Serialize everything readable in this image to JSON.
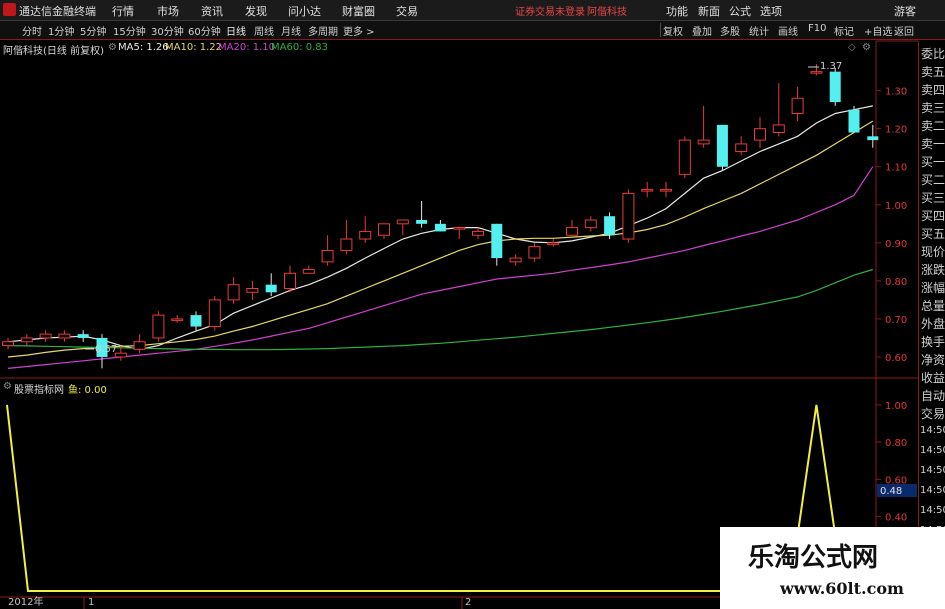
{
  "app": {
    "title": "通达信金融终端"
  },
  "menu": [
    "行情",
    "市场",
    "资讯",
    "发现",
    "问小达",
    "财富圈",
    "交易"
  ],
  "status": {
    "warning": "证券交易未登录",
    "broker": "阿偕科技"
  },
  "menu_right": [
    "功能",
    "新面",
    "公式",
    "选项",
    "游客"
  ],
  "periods": [
    "分时",
    "1分钟",
    "5分钟",
    "15分钟",
    "30分钟",
    "60分钟",
    "日线",
    "周线",
    "月线",
    "多周期",
    "更多 >"
  ],
  "tools": [
    "复权",
    "叠加",
    "多股",
    "统计",
    "画线",
    "F10",
    "标记",
    "+自选",
    "返回"
  ],
  "stock_legend": {
    "title": "阿偕科技(日线 前复权)",
    "ma5": "MA5: 1.26",
    "ma10": "MA10: 1.22",
    "ma20": "MA20: 1.10",
    "ma60": "MA60: 0.83"
  },
  "indicator_legend": {
    "name": "股票指标网",
    "value": "鱼: 0.00"
  },
  "annotations": {
    "high": "1.37",
    "low": "0.57",
    "cursor_value": "0.48"
  },
  "year_label": "2012年",
  "month_labels": [
    "1",
    "2"
  ],
  "colors": {
    "up": "#e83a3a",
    "down": "#54f0f0",
    "ma5": "#e8e8e8",
    "ma10": "#e8d860",
    "ma20": "#d040d0",
    "ma60": "#30b040",
    "indicator": "#f0f040",
    "grid": "#8a1a1a"
  },
  "right_names": [
    "委比",
    "卖五",
    "卖四",
    "卖三",
    "卖二",
    "卖一",
    "买一",
    "买二",
    "买三",
    "买四",
    "买五",
    "现价",
    "涨跌",
    "涨幅",
    "总量",
    "外盘",
    "换手",
    "净资",
    "收益",
    "自动",
    "交易"
  ],
  "watermark": {
    "cn": "乐淘公式网",
    "url": "www.60lt.com"
  },
  "chart_data": [
    {
      "type": "candlestick",
      "title": "阿偕科技(日线 前复权)",
      "ylim": [
        0.55,
        1.42
      ],
      "y_ticks": [
        "1.30",
        "1.20",
        "1.10",
        "1.00",
        "0.90",
        "0.80",
        "0.70",
        "0.60"
      ],
      "candles": [
        {
          "o": 0.63,
          "h": 0.65,
          "l": 0.62,
          "c": 0.64
        },
        {
          "o": 0.64,
          "h": 0.66,
          "l": 0.63,
          "c": 0.65
        },
        {
          "o": 0.65,
          "h": 0.67,
          "l": 0.64,
          "c": 0.66
        },
        {
          "o": 0.65,
          "h": 0.67,
          "l": 0.64,
          "c": 0.66
        },
        {
          "o": 0.66,
          "h": 0.67,
          "l": 0.64,
          "c": 0.65
        },
        {
          "o": 0.65,
          "h": 0.66,
          "l": 0.57,
          "c": 0.6
        },
        {
          "o": 0.6,
          "h": 0.63,
          "l": 0.59,
          "c": 0.61
        },
        {
          "o": 0.62,
          "h": 0.66,
          "l": 0.61,
          "c": 0.64
        },
        {
          "o": 0.65,
          "h": 0.72,
          "l": 0.64,
          "c": 0.71
        },
        {
          "o": 0.7,
          "h": 0.71,
          "l": 0.69,
          "c": 0.7
        },
        {
          "o": 0.71,
          "h": 0.72,
          "l": 0.67,
          "c": 0.68
        },
        {
          "o": 0.68,
          "h": 0.76,
          "l": 0.67,
          "c": 0.75
        },
        {
          "o": 0.75,
          "h": 0.81,
          "l": 0.74,
          "c": 0.79
        },
        {
          "o": 0.77,
          "h": 0.8,
          "l": 0.75,
          "c": 0.78
        },
        {
          "o": 0.79,
          "h": 0.82,
          "l": 0.76,
          "c": 0.77
        },
        {
          "o": 0.78,
          "h": 0.84,
          "l": 0.77,
          "c": 0.82
        },
        {
          "o": 0.82,
          "h": 0.84,
          "l": 0.82,
          "c": 0.83
        },
        {
          "o": 0.85,
          "h": 0.92,
          "l": 0.84,
          "c": 0.88
        },
        {
          "o": 0.88,
          "h": 0.96,
          "l": 0.87,
          "c": 0.91
        },
        {
          "o": 0.91,
          "h": 0.97,
          "l": 0.9,
          "c": 0.93
        },
        {
          "o": 0.92,
          "h": 0.95,
          "l": 0.91,
          "c": 0.95
        },
        {
          "o": 0.95,
          "h": 0.96,
          "l": 0.92,
          "c": 0.96
        },
        {
          "o": 0.96,
          "h": 1.01,
          "l": 0.94,
          "c": 0.95
        },
        {
          "o": 0.95,
          "h": 0.96,
          "l": 0.93,
          "c": 0.93
        },
        {
          "o": 0.94,
          "h": 0.94,
          "l": 0.91,
          "c": 0.94
        },
        {
          "o": 0.92,
          "h": 0.94,
          "l": 0.91,
          "c": 0.93
        },
        {
          "o": 0.95,
          "h": 0.95,
          "l": 0.84,
          "c": 0.86
        },
        {
          "o": 0.85,
          "h": 0.87,
          "l": 0.84,
          "c": 0.86
        },
        {
          "o": 0.86,
          "h": 0.9,
          "l": 0.85,
          "c": 0.89
        },
        {
          "o": 0.9,
          "h": 0.91,
          "l": 0.89,
          "c": 0.9
        },
        {
          "o": 0.92,
          "h": 0.96,
          "l": 0.92,
          "c": 0.94
        },
        {
          "o": 0.94,
          "h": 0.97,
          "l": 0.93,
          "c": 0.96
        },
        {
          "o": 0.97,
          "h": 0.98,
          "l": 0.91,
          "c": 0.92
        },
        {
          "o": 0.91,
          "h": 1.04,
          "l": 0.9,
          "c": 1.03
        },
        {
          "o": 1.04,
          "h": 1.06,
          "l": 1.02,
          "c": 1.04
        },
        {
          "o": 1.04,
          "h": 1.06,
          "l": 1.02,
          "c": 1.04
        },
        {
          "o": 1.08,
          "h": 1.18,
          "l": 1.07,
          "c": 1.17
        },
        {
          "o": 1.16,
          "h": 1.26,
          "l": 1.15,
          "c": 1.17
        },
        {
          "o": 1.21,
          "h": 1.21,
          "l": 1.09,
          "c": 1.1
        },
        {
          "o": 1.14,
          "h": 1.18,
          "l": 1.13,
          "c": 1.16
        },
        {
          "o": 1.17,
          "h": 1.23,
          "l": 1.15,
          "c": 1.2
        },
        {
          "o": 1.19,
          "h": 1.32,
          "l": 1.18,
          "c": 1.21
        },
        {
          "o": 1.24,
          "h": 1.31,
          "l": 1.22,
          "c": 1.28
        },
        {
          "o": 1.35,
          "h": 1.37,
          "l": 1.34,
          "c": 1.35
        },
        {
          "o": 1.35,
          "h": 1.36,
          "l": 1.26,
          "c": 1.27
        },
        {
          "o": 1.25,
          "h": 1.26,
          "l": 1.19,
          "c": 1.19
        },
        {
          "o": 1.18,
          "h": 1.21,
          "l": 1.15,
          "c": 1.17
        }
      ],
      "ma_lines": [
        {
          "name": "MA5",
          "values": [
            0.64,
            0.645,
            0.65,
            0.652,
            0.655,
            0.645,
            0.63,
            0.62,
            0.63,
            0.65,
            0.668,
            0.685,
            0.715,
            0.735,
            0.755,
            0.775,
            0.79,
            0.81,
            0.833,
            0.86,
            0.885,
            0.91,
            0.925,
            0.935,
            0.94,
            0.94,
            0.925,
            0.91,
            0.902,
            0.9,
            0.905,
            0.915,
            0.925,
            0.945,
            0.965,
            0.99,
            1.03,
            1.07,
            1.09,
            1.115,
            1.14,
            1.16,
            1.18,
            1.215,
            1.24,
            1.25,
            1.26
          ]
        },
        {
          "name": "MA10",
          "values": [
            0.6,
            0.605,
            0.612,
            0.618,
            0.622,
            0.625,
            0.628,
            0.63,
            0.635,
            0.64,
            0.646,
            0.655,
            0.668,
            0.68,
            0.695,
            0.71,
            0.725,
            0.74,
            0.76,
            0.78,
            0.8,
            0.82,
            0.84,
            0.86,
            0.88,
            0.895,
            0.905,
            0.91,
            0.912,
            0.912,
            0.915,
            0.918,
            0.92,
            0.926,
            0.935,
            0.948,
            0.968,
            0.99,
            1.01,
            1.03,
            1.055,
            1.08,
            1.105,
            1.13,
            1.16,
            1.19,
            1.22
          ]
        },
        {
          "name": "MA20",
          "values": [
            0.57,
            0.575,
            0.58,
            0.585,
            0.59,
            0.595,
            0.6,
            0.605,
            0.61,
            0.615,
            0.62,
            0.628,
            0.636,
            0.645,
            0.655,
            0.665,
            0.675,
            0.69,
            0.705,
            0.72,
            0.735,
            0.75,
            0.765,
            0.775,
            0.785,
            0.795,
            0.805,
            0.81,
            0.815,
            0.82,
            0.828,
            0.835,
            0.842,
            0.85,
            0.86,
            0.87,
            0.88,
            0.893,
            0.905,
            0.918,
            0.93,
            0.945,
            0.96,
            0.98,
            1.0,
            1.025,
            1.1
          ]
        },
        {
          "name": "MA60",
          "values": [
            0.63,
            0.629,
            0.628,
            0.627,
            0.626,
            0.625,
            0.624,
            0.623,
            0.622,
            0.621,
            0.62,
            0.62,
            0.619,
            0.619,
            0.619,
            0.62,
            0.621,
            0.622,
            0.624,
            0.626,
            0.628,
            0.63,
            0.633,
            0.636,
            0.64,
            0.644,
            0.648,
            0.652,
            0.657,
            0.662,
            0.667,
            0.672,
            0.678,
            0.684,
            0.69,
            0.697,
            0.704,
            0.712,
            0.72,
            0.729,
            0.738,
            0.748,
            0.758,
            0.775,
            0.795,
            0.815,
            0.83
          ]
        }
      ]
    },
    {
      "type": "line",
      "title": "股票指标网",
      "series_name": "鱼",
      "ylim": [
        0.0,
        1.08
      ],
      "y_ticks": [
        "1.00",
        "0.80",
        "0.60",
        "0.40"
      ],
      "right_labels": [
        "14:50",
        "14:50",
        "14:50",
        "14:50",
        "14:50",
        "14:50",
        "14:50",
        "14:50"
      ],
      "x_idx": [
        0,
        1,
        2,
        40,
        41,
        42,
        43,
        44,
        45,
        46
      ],
      "values": [
        1.0,
        0.0,
        0.0,
        0.0,
        0.0,
        0.3,
        1.0,
        0.3,
        0.0,
        0.0
      ]
    }
  ]
}
